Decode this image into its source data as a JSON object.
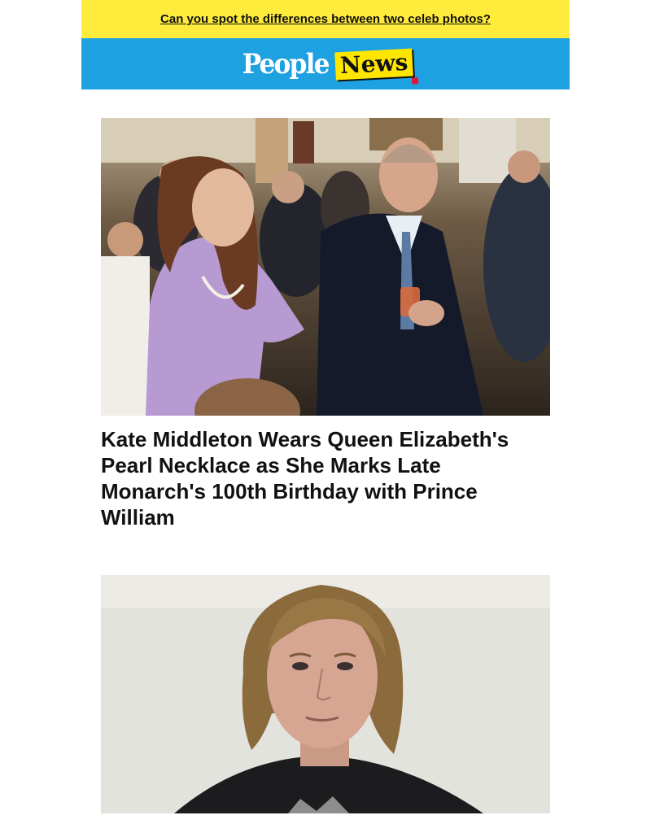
{
  "promo": {
    "link_text": "Can you spot the differences between two celeb photos?",
    "background": "#ffeb3b"
  },
  "masthead": {
    "logo_people": "People",
    "logo_news": "News",
    "background": "#1ea1e0"
  },
  "articles": [
    {
      "image_alt": "Kate Middleton in a lilac dress and pearl necklace talking with Prince William at a palace reception",
      "headline": "Kate Middleton Wears Queen Elizabeth's Pearl Necklace as She Marks Late Monarch's 100th Birthday with Prince William"
    },
    {
      "image_alt": "Portrait of a man with long shoulder-length hair against a light wall",
      "headline": ""
    }
  ]
}
